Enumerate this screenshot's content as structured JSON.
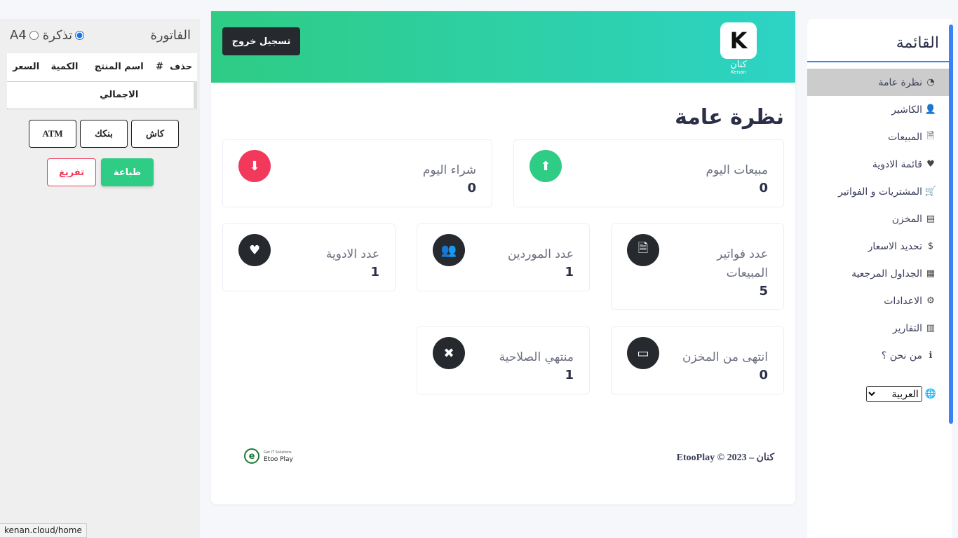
{
  "sidebar": {
    "title": "القائمة",
    "items": [
      {
        "label": "نظرة عامة",
        "icon": "tachometer-icon",
        "glyph": "◔",
        "active": true
      },
      {
        "label": "الكاشير",
        "icon": "user-icon",
        "glyph": "👤",
        "active": false
      },
      {
        "label": "المبيعات",
        "icon": "file-icon",
        "glyph": "🗎",
        "active": false
      },
      {
        "label": "قائمة الادوية",
        "icon": "heart-icon",
        "glyph": "♥",
        "active": false
      },
      {
        "label": "المشتريات و الفواتير",
        "icon": "cart-icon",
        "glyph": "🛒",
        "active": false
      },
      {
        "label": "المخزن",
        "icon": "archive-icon",
        "glyph": "▤",
        "active": false
      },
      {
        "label": "تحديد الاسعار",
        "icon": "dollar-icon",
        "glyph": "$",
        "active": false
      },
      {
        "label": "الجداول المرجعية",
        "icon": "table-icon",
        "glyph": "▦",
        "active": false
      },
      {
        "label": "الاعدادات",
        "icon": "gear-icon",
        "glyph": "⚙",
        "active": false
      },
      {
        "label": "التقارير",
        "icon": "bar-chart-icon",
        "glyph": "▥",
        "active": false
      },
      {
        "label": "من نحن ؟",
        "icon": "info-icon",
        "glyph": "ℹ",
        "active": false
      }
    ],
    "language": {
      "selected": "العربية",
      "icon": "language-icon"
    }
  },
  "header": {
    "logout_label": "تسجيل خروج",
    "logo_letter": "K",
    "logo_name": "كنان",
    "logo_sub": "Kenan"
  },
  "main": {
    "title": "نظرة عامة",
    "stats": [
      {
        "key": "today_sales",
        "label": "مبيعات اليوم",
        "value": "0",
        "icon": "arrow-up-icon",
        "glyph": "⬆",
        "color": "#2ecc84"
      },
      {
        "key": "today_purchases",
        "label": "شراء اليوم",
        "value": "0",
        "icon": "arrow-down-icon",
        "glyph": "⬇",
        "color": "#f2395b"
      },
      {
        "key": "sales_invoices",
        "label": "عدد فواتير المبيعات",
        "value": "5",
        "icon": "file-icon",
        "glyph": "🗎",
        "color": "#262a2e"
      },
      {
        "key": "suppliers",
        "label": "عدد الموردين",
        "value": "1",
        "icon": "users-icon",
        "glyph": "👥",
        "color": "#262a2e"
      },
      {
        "key": "medicines",
        "label": "عدد الادوية",
        "value": "1",
        "icon": "heart-icon",
        "glyph": "♥",
        "color": "#262a2e"
      },
      {
        "key": "out_of_stock",
        "label": "انتهى من المخزن",
        "value": "0",
        "icon": "battery-empty-icon",
        "glyph": "▭",
        "color": "#262a2e"
      },
      {
        "key": "expired",
        "label": "منتهي الصلاحية",
        "value": "1",
        "icon": "close-icon",
        "glyph": "✖",
        "color": "#262a2e"
      }
    ],
    "footer": {
      "copyright": "كنان – 2023 © EtooPlay",
      "brand_small": "Get IT Solutions",
      "brand_name": "Etoo Play",
      "brand_mark": "e"
    }
  },
  "invoice": {
    "title": "الفاتورة",
    "print_options": [
      {
        "label": "تذكرة",
        "selected": true
      },
      {
        "label": "A4",
        "selected": false
      }
    ],
    "columns": [
      "حذف",
      "#",
      "اسم المنتج",
      "الكمية",
      "السعر"
    ],
    "total_label": "الاجمالي",
    "payment_methods": [
      "كاش",
      "بنكك",
      "ATM"
    ],
    "print_label": "طباعة",
    "clear_label": "تفريغ"
  },
  "status_bar": {
    "url": "kenan.cloud/home"
  }
}
